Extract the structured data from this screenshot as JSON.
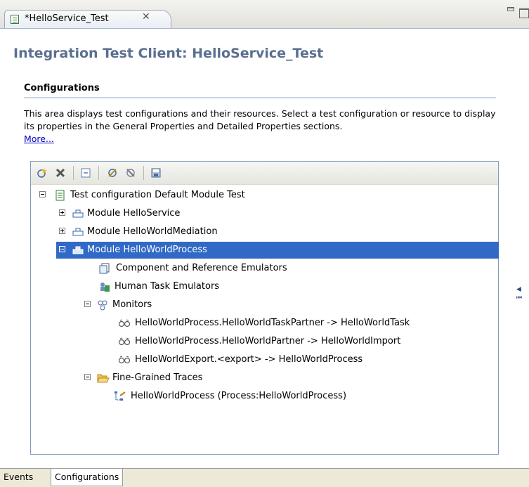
{
  "editor_tab": {
    "title": "*HelloService_Test",
    "close": "✕"
  },
  "form": {
    "title": "Integration Test Client: HelloService_Test",
    "section": {
      "title": "Configurations",
      "description": "This area displays test configurations and their resources. Select a test configuration or resource to display its properties in the General Properties and Detailed Properties sections.",
      "more_link": "More..."
    }
  },
  "toolbar": {
    "buttons": [
      "new-configuration-icon",
      "delete-icon",
      "collapse-all-icon",
      "attach-icon",
      "detach-icon",
      "save-icon"
    ]
  },
  "tree": {
    "root": "Test configuration Default Module Test",
    "module_hello_service": "Module HelloService",
    "module_hello_world_mediation": "Module HelloWorldMediation",
    "module_hello_world_process": "Module HelloWorldProcess",
    "component_emulators": "Component and Reference Emulators",
    "human_task_emulators": "Human Task Emulators",
    "monitors": "Monitors",
    "monitor_1": "HelloWorldProcess.HelloWorldTaskPartner -> HelloWorldTask",
    "monitor_2": "HelloWorldProcess.HelloWorldPartner -> HelloWorldImport",
    "monitor_3": "HelloWorldExport.<export> -> HelloWorldProcess",
    "fine_grained_traces": "Fine-Grained Traces",
    "trace_1": "HelloWorldProcess (Process:HelloWorldProcess)"
  },
  "bottom_tabs": {
    "events": "Events",
    "configurations": "Configurations"
  },
  "colors": {
    "selection": "#3169c6",
    "title": "#5a7090",
    "link": "#0000cc"
  }
}
